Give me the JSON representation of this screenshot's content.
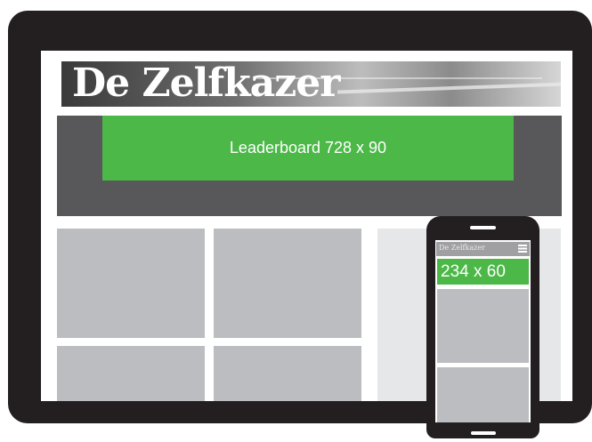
{
  "masthead": {
    "logo_text": "De Zelfkazer"
  },
  "leaderboard": {
    "label": "Leaderboard 728 x 90"
  },
  "phone": {
    "logo_text": "De Zelfkazer",
    "ad_label": "234 x 60"
  },
  "colors": {
    "device_frame": "#231f20",
    "ad_green": "#4cb848",
    "band_gray": "#58585a",
    "tile_gray": "#bcbdc0",
    "sidebar_gray": "#e6e7e8"
  },
  "icons": {
    "phone_menu": "hamburger-menu-icon"
  }
}
